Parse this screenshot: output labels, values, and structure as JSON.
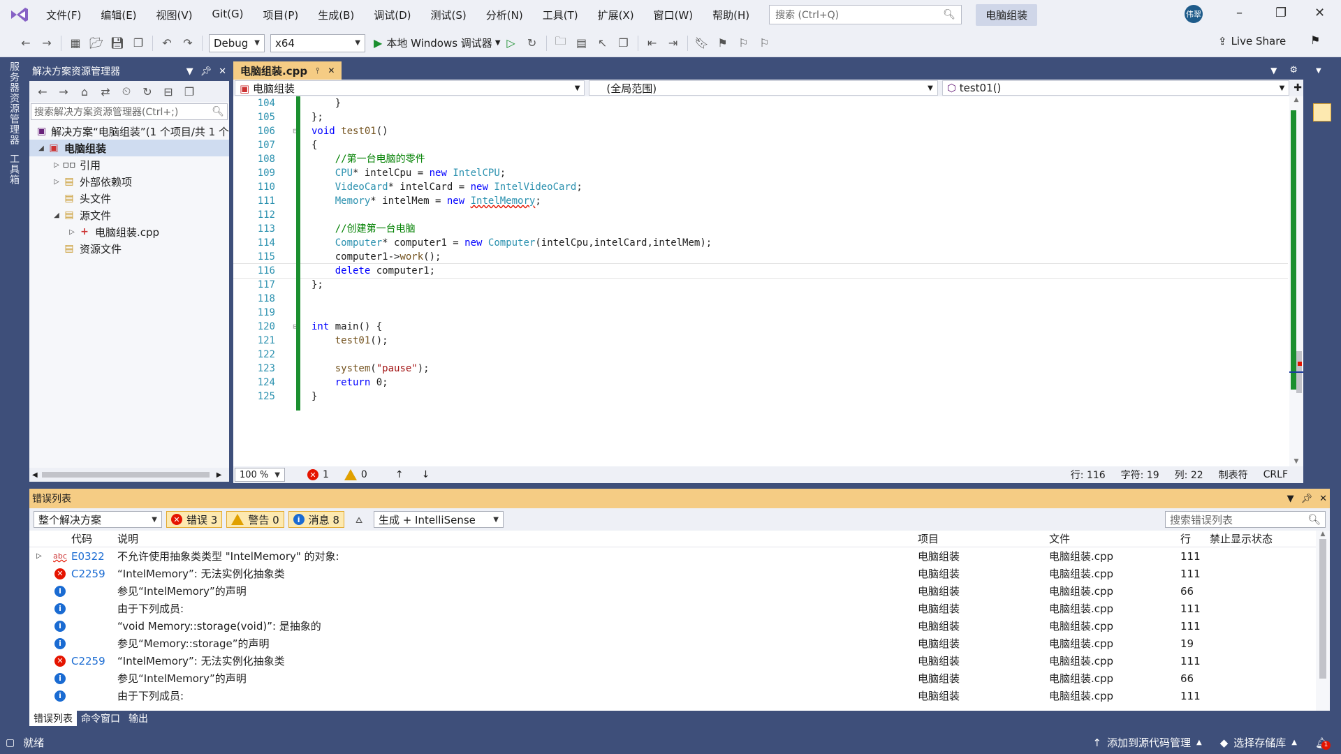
{
  "menu": [
    "文件(F)",
    "编辑(E)",
    "视图(V)",
    "Git(G)",
    "项目(P)",
    "生成(B)",
    "调试(D)",
    "测试(S)",
    "分析(N)",
    "工具(T)",
    "扩展(X)",
    "窗口(W)",
    "帮助(H)"
  ],
  "search": {
    "placeholder": "搜索 (Ctrl+Q)"
  },
  "solution_title": "电脑组装",
  "avatar": "伟翠",
  "toolbar": {
    "config": "Debug",
    "platform": "x64",
    "debugger": "本地 Windows 调试器",
    "live_share": "Live Share"
  },
  "leftstrip": {
    "server_explorer": "服务器资源管理器",
    "toolbox": "工具箱"
  },
  "solution_explorer": {
    "title": "解决方案资源管理器",
    "search": "搜索解决方案资源管理器(Ctrl+;)",
    "solution": "解决方案“电脑组装”(1 个项目/共 1 个",
    "project": "电脑组装",
    "nodes": [
      "引用",
      "外部依赖项",
      "头文件",
      "源文件",
      "电脑组装.cpp",
      "资源文件"
    ]
  },
  "editor": {
    "tab": "电脑组装.cpp",
    "nav": {
      "project": "电脑组装",
      "scope": "(全局范围)",
      "member": "test01()"
    },
    "zoom": "100 %",
    "errors": "1",
    "warnings": "0",
    "line_info": "行: 116",
    "char_info": "字符: 19",
    "col_info": "列: 22",
    "tabs": "制表符",
    "eol": "CRLF",
    "lines": [
      {
        "n": "104",
        "t": "    }"
      },
      {
        "n": "105",
        "t": "};"
      },
      {
        "n": "106",
        "t": "void test01()"
      },
      {
        "n": "107",
        "t": "{"
      },
      {
        "n": "108",
        "t": "    //第一台电脑的零件"
      },
      {
        "n": "109",
        "t": "    CPU* intelCpu = new IntelCPU;"
      },
      {
        "n": "110",
        "t": "    VideoCard* intelCard = new IntelVideoCard;"
      },
      {
        "n": "111",
        "t": "    Memory* intelMem = new IntelMemory;"
      },
      {
        "n": "112",
        "t": ""
      },
      {
        "n": "113",
        "t": "    //创建第一台电脑"
      },
      {
        "n": "114",
        "t": "    Computer* computer1 = new Computer(intelCpu,intelCard,intelMem);"
      },
      {
        "n": "115",
        "t": "    computer1->work();"
      },
      {
        "n": "116",
        "t": "    delete computer1;"
      },
      {
        "n": "117",
        "t": "};"
      },
      {
        "n": "118",
        "t": ""
      },
      {
        "n": "119",
        "t": ""
      },
      {
        "n": "120",
        "t": "int main() {"
      },
      {
        "n": "121",
        "t": "    test01();"
      },
      {
        "n": "122",
        "t": ""
      },
      {
        "n": "123",
        "t": "    system(\"pause\");"
      },
      {
        "n": "124",
        "t": "    return 0;"
      },
      {
        "n": "125",
        "t": "}"
      }
    ]
  },
  "error_list": {
    "title": "错误列表",
    "scope": "整个解决方案",
    "errors_btn": "错误 3",
    "warnings_btn": "警告 0",
    "messages_btn": "消息 8",
    "build_filter": "生成 + IntelliSense",
    "search": "搜索错误列表",
    "headers": {
      "code": "代码",
      "desc": "说明",
      "project": "项目",
      "file": "文件",
      "line": "行",
      "suppress": "禁止显示状态"
    },
    "rows": [
      {
        "kind": "abc",
        "code": "E0322",
        "desc": "不允许使用抽象类类型 \"IntelMemory\" 的对象:",
        "project": "电脑组装",
        "file": "电脑组装.cpp",
        "line": "111"
      },
      {
        "kind": "err",
        "code": "C2259",
        "desc": "“IntelMemory”: 无法实例化抽象类",
        "project": "电脑组装",
        "file": "电脑组装.cpp",
        "line": "111"
      },
      {
        "kind": "info",
        "code": "",
        "desc": "参见“IntelMemory”的声明",
        "project": "电脑组装",
        "file": "电脑组装.cpp",
        "line": "66"
      },
      {
        "kind": "info",
        "code": "",
        "desc": "由于下列成员:",
        "project": "电脑组装",
        "file": "电脑组装.cpp",
        "line": "111"
      },
      {
        "kind": "info",
        "code": "",
        "desc": "“void Memory::storage(void)”: 是抽象的",
        "project": "电脑组装",
        "file": "电脑组装.cpp",
        "line": "111"
      },
      {
        "kind": "info",
        "code": "",
        "desc": "参见“Memory::storage”的声明",
        "project": "电脑组装",
        "file": "电脑组装.cpp",
        "line": "19"
      },
      {
        "kind": "err",
        "code": "C2259",
        "desc": "“IntelMemory”: 无法实例化抽象类",
        "project": "电脑组装",
        "file": "电脑组装.cpp",
        "line": "111"
      },
      {
        "kind": "info",
        "code": "",
        "desc": "参见“IntelMemory”的声明",
        "project": "电脑组装",
        "file": "电脑组装.cpp",
        "line": "66"
      },
      {
        "kind": "info",
        "code": "",
        "desc": "由于下列成员:",
        "project": "电脑组装",
        "file": "电脑组装.cpp",
        "line": "111"
      }
    ],
    "tabs": [
      "错误列表",
      "命令窗口",
      "输出"
    ]
  },
  "statusbar": {
    "ready": "就绪",
    "source_control": "添加到源代码管理",
    "repo": "选择存储库",
    "notif": "1"
  }
}
